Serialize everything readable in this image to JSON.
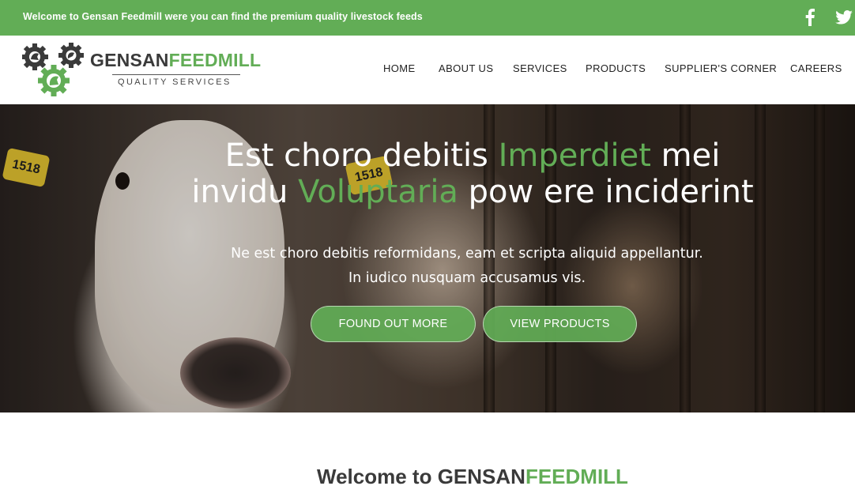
{
  "topbar": {
    "message": "Welcome to Gensan Feedmill were you can find the premium quality livestock feeds",
    "social": [
      {
        "name": "facebook-icon"
      },
      {
        "name": "twitter-icon"
      }
    ]
  },
  "logo": {
    "word_dark": "GENSAN",
    "word_green": "FEEDMILL",
    "tagline": "QUALITY SERVICES"
  },
  "nav": [
    "HOME",
    "ABOUT US",
    "SERVICES",
    "PRODUCTS",
    "SUPPLIER'S CORNER",
    "CAREERS"
  ],
  "hero": {
    "title_line1_a": "Est choro debitis ",
    "title_line1_b": "Imperdiet",
    "title_line1_c": " mei",
    "title_line2_a": "invidu ",
    "title_line2_b": "Voluptaria",
    "title_line2_c": " pow ere inciderint",
    "text": "Ne est choro debitis reformidans, eam et scripta aliquid appellantur. In iudico nusquam accusamus vis.",
    "buttons": [
      "FOUND OUT MORE",
      "VIEW PRODUCTS"
    ],
    "ear_tags": [
      "1518",
      "1518"
    ]
  },
  "welcome": {
    "prefix": "Welcome to ",
    "brand_dark": "GENSAN",
    "brand_green": "FEEDMILL"
  },
  "colors": {
    "brand_green": "#62ad56",
    "text_dark": "#3a3a3a",
    "white": "#ffffff"
  }
}
